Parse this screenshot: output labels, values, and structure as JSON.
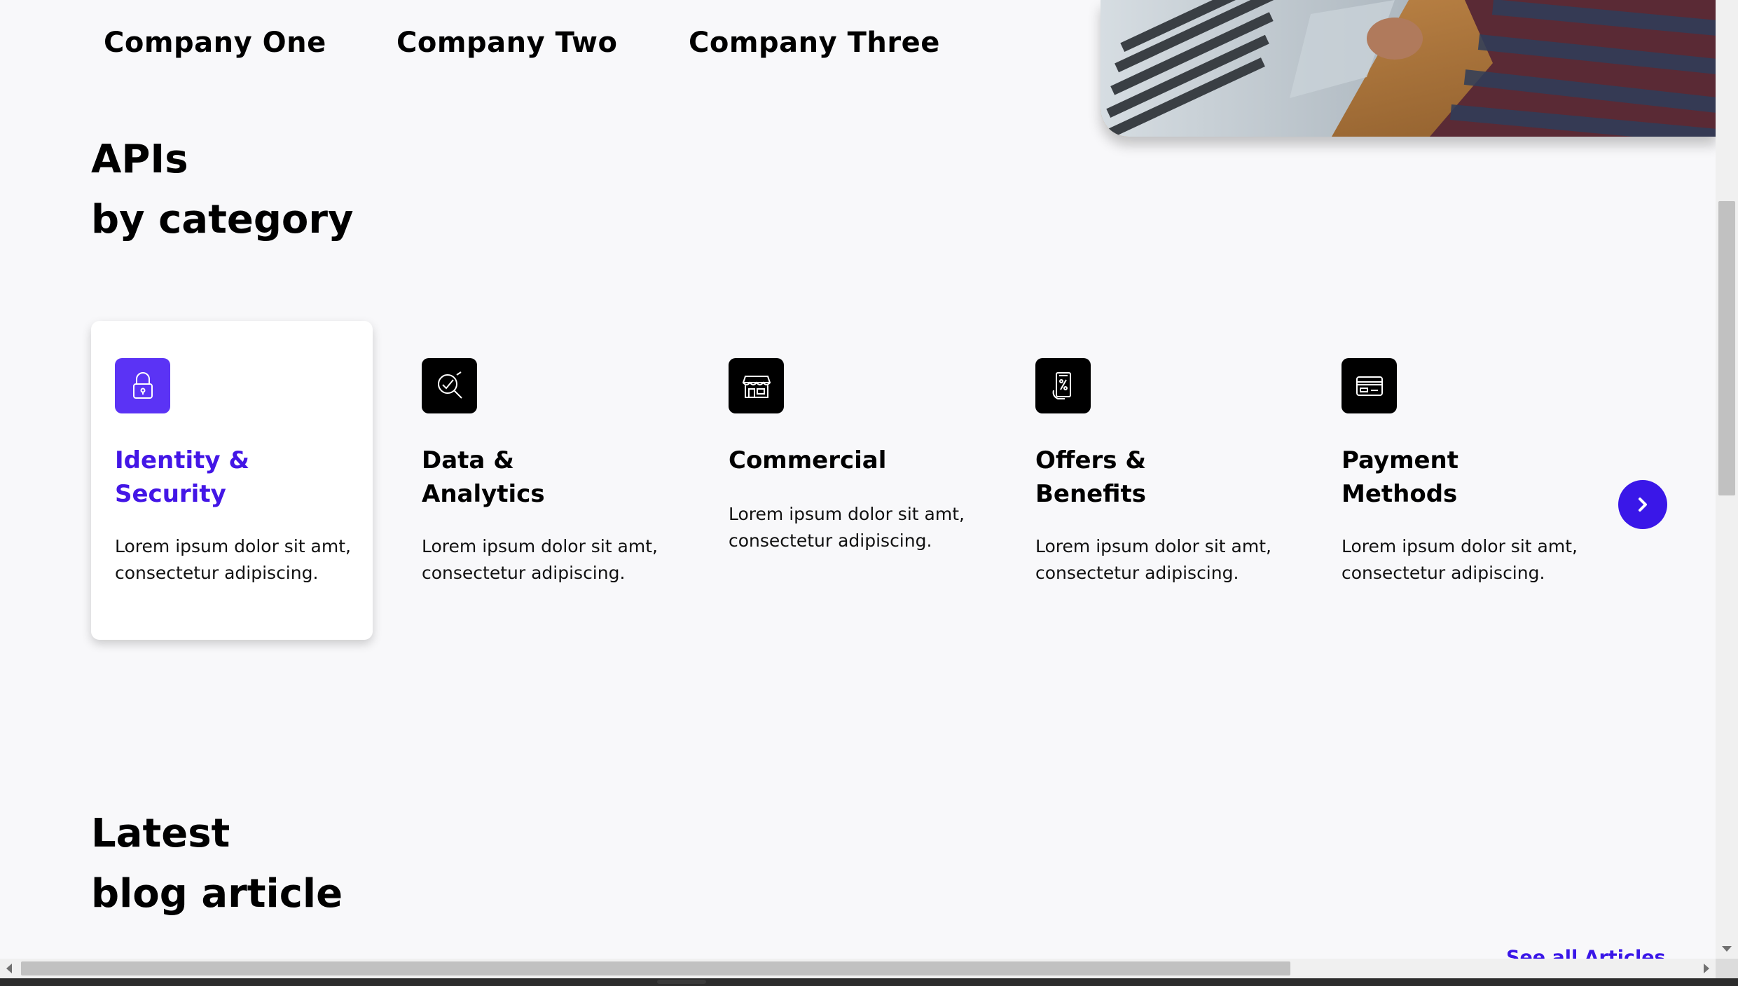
{
  "companies": [
    "Company One",
    "Company Two",
    "Company Three"
  ],
  "apis_heading": {
    "line1": "APIs",
    "line2": "by category"
  },
  "categories": [
    {
      "title_line1": "Identity &",
      "title_line2": "Security",
      "description": "Lorem ipsum dolor sit amt, consectetur adipiscing.",
      "icon": "lock-icon",
      "active": true
    },
    {
      "title_line1": "Data &",
      "title_line2": "Analytics",
      "description": "Lorem ipsum dolor sit amt, consectetur adipiscing.",
      "icon": "analytics-search-icon",
      "active": false
    },
    {
      "title_line1": "Commercial",
      "title_line2": "",
      "description": "Lorem ipsum dolor sit amt, consectetur adipiscing.",
      "icon": "storefront-icon",
      "active": false
    },
    {
      "title_line1": "Offers &",
      "title_line2": "Benefits",
      "description": "Lorem ipsum dolor sit amt, consectetur adipiscing.",
      "icon": "mobile-offer-icon",
      "active": false
    },
    {
      "title_line1": "Payment",
      "title_line2": "Methods",
      "description": "Lorem ipsum dolor sit amt, consectetur adipiscing.",
      "icon": "credit-card-icon",
      "active": false
    }
  ],
  "blog_heading": {
    "line1": "Latest",
    "line2": "blog article"
  },
  "see_all_label": "See all Articles",
  "colors": {
    "accent": "#3a17e8",
    "active_title": "#4316e6",
    "active_icon_bg": "#5b33f5",
    "icon_bg": "#000000",
    "page_bg": "#f8f8fa"
  }
}
